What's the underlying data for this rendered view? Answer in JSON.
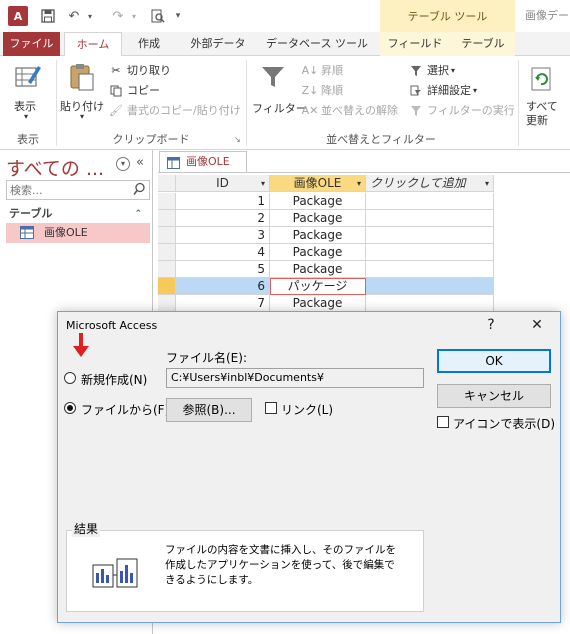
{
  "titlebar": {
    "context_group": "テーブル ツール",
    "window_title": "画像データ",
    "logo_text": "A"
  },
  "ribbon_tabs": {
    "file": "ファイル",
    "home": "ホーム",
    "create": "作成",
    "external": "外部データ",
    "database_tools": "データベース ツール",
    "fields": "フィールド",
    "table": "テーブル"
  },
  "ribbon": {
    "view": {
      "label": "表示",
      "group": "表示"
    },
    "clipboard": {
      "paste": "貼り付け",
      "cut": "切り取り",
      "copy": "コピー",
      "format_painter": "書式のコピー/貼り付け",
      "group": "クリップボード"
    },
    "sort": {
      "filter": "フィルター",
      "ascending": "昇順",
      "descending": "降順",
      "clear_sort": "並べ替えの解除",
      "selection": "選択",
      "advanced": "詳細設定",
      "toggle_filter": "フィルターの実行",
      "group": "並べ替えとフィルター"
    },
    "records": {
      "refresh": "すべて",
      "refresh2": "更新"
    }
  },
  "nav": {
    "title": "すべての ...",
    "search_placeholder": "検索...",
    "group": "テーブル",
    "item": "画像OLE"
  },
  "document": {
    "tab": "画像OLE",
    "columns": [
      "ID",
      "画像OLE",
      "クリックして追加"
    ],
    "rows": [
      {
        "id": "1",
        "val": "Package"
      },
      {
        "id": "2",
        "val": "Package"
      },
      {
        "id": "3",
        "val": "Package"
      },
      {
        "id": "4",
        "val": "Package"
      },
      {
        "id": "5",
        "val": "Package"
      },
      {
        "id": "6",
        "val": "パッケージ"
      },
      {
        "id": "7",
        "val": "Package"
      }
    ],
    "selected_row_index": 5
  },
  "dialog": {
    "title": "Microsoft Access",
    "help": "?",
    "close": "✕",
    "create_new": "新規作成(N)",
    "from_file": "ファイルから(F)",
    "filename_label": "ファイル名(E):",
    "filename_value": "C:¥Users¥inbl¥Documents¥",
    "browse": "参照(B)...",
    "link": "リンク(L)",
    "ok": "OK",
    "cancel": "キャンセル",
    "display_as_icon": "アイコンで表示(D)",
    "result_label": "結果",
    "result_line1": "ファイルの内容を文書に挿入し、そのファイルを",
    "result_line2": "作成したアプリケーションを使って、後で編集で",
    "result_line3": "きるようにします。"
  },
  "colors": {
    "brand": "#a4373a",
    "context_tab": "#fdf0c1",
    "selected_row": "#bbd8f5",
    "nav_selected": "#f8c8c8",
    "arrow": "#e02020"
  }
}
